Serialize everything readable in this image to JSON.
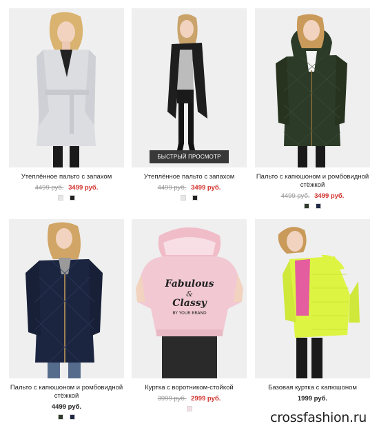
{
  "quick_view_label": "БЫСТРЫЙ ПРОСМОТР",
  "watermark": "crossfashion.ru",
  "products": [
    {
      "name": "Утеплённое пальто с запахом",
      "old_price": "4499 руб.",
      "price": "3499 руб.",
      "swatches": [
        "#e6e6e6",
        "#222222"
      ],
      "coat_color": "#dcdde1",
      "image_alt": "woman-in-light-grey-wrap-coat"
    },
    {
      "name": "Утеплённое пальто с запахом",
      "old_price": "4499 руб.",
      "price": "3499 руб.",
      "swatches": [
        "#e6e6e6",
        "#222222"
      ],
      "coat_color": "#1e1e1e",
      "image_alt": "woman-in-black-wrap-coat"
    },
    {
      "name": "Пальто с капюшоном и ромбовидной стёжкой",
      "old_price": "4499 руб.",
      "price": "3499 руб.",
      "swatches": [
        "#2f3a2c",
        "#1f2a44"
      ],
      "coat_color": "#2c3a28",
      "image_alt": "woman-in-dark-green-quilted-coat"
    },
    {
      "name": "Пальто с капюшоном и ромбовидной стёжкой",
      "old_price": "",
      "price": "4499 руб.",
      "swatches": [
        "#2f3a2c",
        "#1f2a44"
      ],
      "coat_color": "#1c2540",
      "image_alt": "woman-in-navy-quilted-coat"
    },
    {
      "name": "Куртка с воротником-стойкой",
      "old_price": "3999 руб.",
      "price": "2999 руб.",
      "swatches": [
        "#f2dfe3"
      ],
      "coat_color": "#f2c9d3",
      "back_print": [
        "Fabulous",
        "&",
        "Classy",
        "BY YOUR BRAND"
      ],
      "image_alt": "back-of-pink-jacket-with-print"
    },
    {
      "name": "Базовая куртка с капюшоном",
      "old_price": "",
      "price": "1999 руб.",
      "swatches": [],
      "coat_color": "#ddf542",
      "image_alt": "woman-in-neon-yellow-jacket"
    }
  ]
}
